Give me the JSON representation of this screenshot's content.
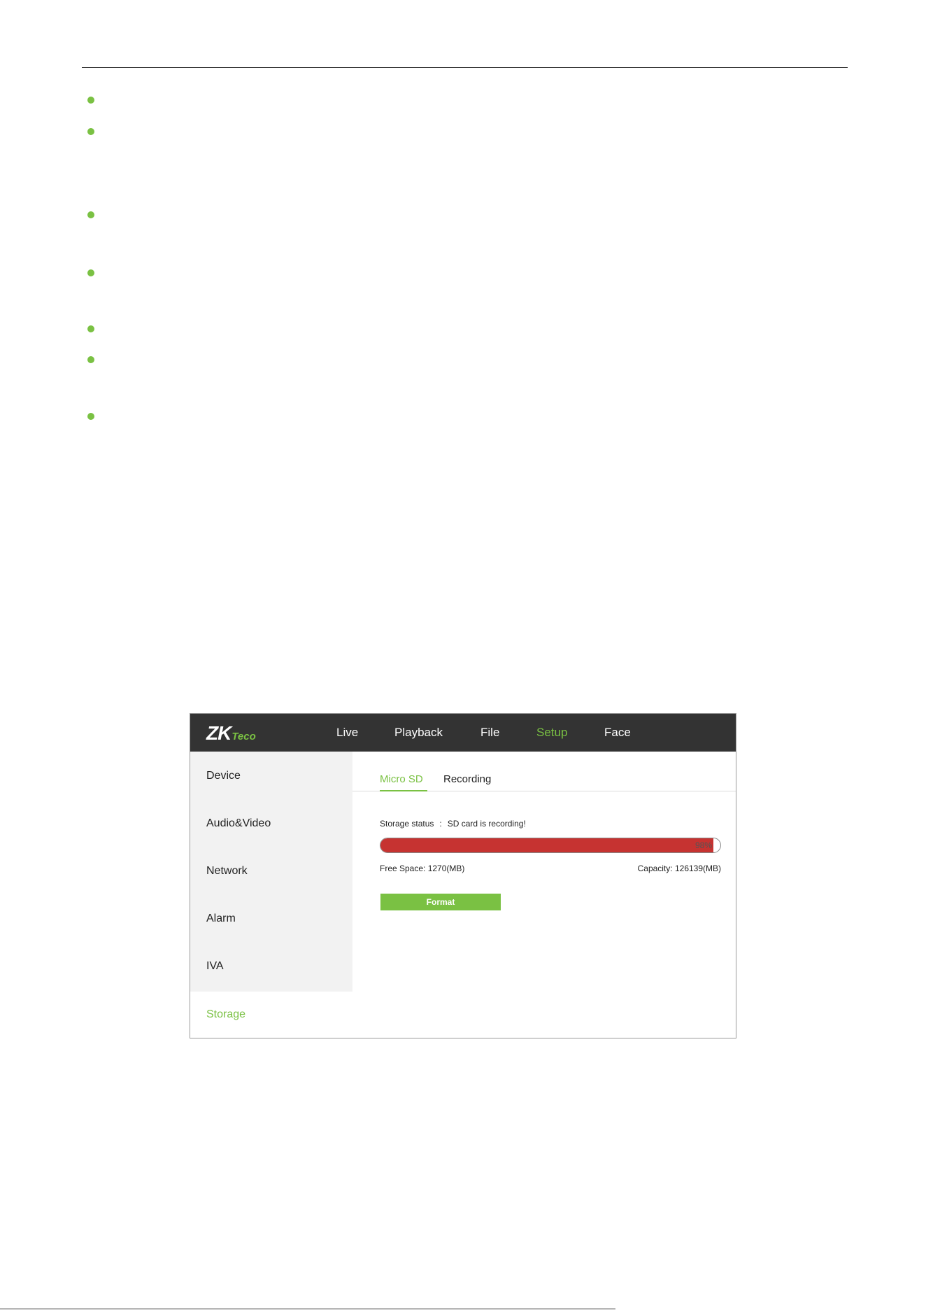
{
  "app": {
    "logo": {
      "main": "ZK",
      "accent": "Teco"
    },
    "nav": [
      {
        "label": "Live",
        "active": false
      },
      {
        "label": "Playback",
        "active": false
      },
      {
        "label": "File",
        "active": false
      },
      {
        "label": "Setup",
        "active": true
      },
      {
        "label": "Face",
        "active": false
      }
    ],
    "sidebar": [
      {
        "label": "Device",
        "active": false
      },
      {
        "label": "Audio&Video",
        "active": false
      },
      {
        "label": "Network",
        "active": false
      },
      {
        "label": "Alarm",
        "active": false
      },
      {
        "label": "IVA",
        "active": false
      },
      {
        "label": "Storage",
        "active": true
      }
    ],
    "tabs": [
      {
        "label": "Micro SD",
        "active": true
      },
      {
        "label": "Recording",
        "active": false
      }
    ],
    "storage": {
      "status_label": "Storage status",
      "status_sep": ":",
      "status_value": "SD card is recording!",
      "usage_percent": 98,
      "usage_text": "98%",
      "free_space": "Free Space: 1270(MB)",
      "capacity": "Capacity: 126139(MB)",
      "format_label": "Format"
    }
  },
  "colors": {
    "accent": "#7ac143",
    "topbar": "#333333",
    "sidebar": "#f2f2f2",
    "progress_fill": "#c63331"
  }
}
